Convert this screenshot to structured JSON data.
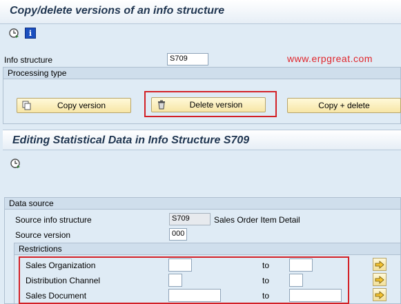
{
  "window": {
    "title": "Copy/delete versions of an info structure"
  },
  "toolbar1": {
    "execute_icon": "execute-clock-icon",
    "info_icon": "info-icon"
  },
  "header_fields": {
    "info_structure_label": "Info structure",
    "info_structure_value": "S709"
  },
  "watermark": "www.erpgreat.com",
  "processing_type": {
    "title": "Processing type",
    "buttons": {
      "copy": "Copy version",
      "delete": "Delete version",
      "copy_delete": "Copy + delete"
    }
  },
  "section2": {
    "title": "Editing Statistical Data in Info Structure S709",
    "execute_icon": "execute-clock-icon"
  },
  "data_source": {
    "title": "Data source",
    "source_info_structure_label": "Source info structure",
    "source_info_structure_value": "S709",
    "source_info_structure_desc": "Sales Order Item Detail",
    "source_version_label": "Source version",
    "source_version_value": "000"
  },
  "restrictions": {
    "title": "Restrictions",
    "to_label": "to",
    "rows": [
      {
        "label": "Sales Organization",
        "from": "",
        "to": ""
      },
      {
        "label": "Distribution Channel",
        "from": "",
        "to": ""
      },
      {
        "label": "Sales Document",
        "from": "",
        "to": ""
      }
    ]
  },
  "colors": {
    "highlight": "#d32026",
    "background": "#dfebf5",
    "button": "#f7e6a6"
  }
}
